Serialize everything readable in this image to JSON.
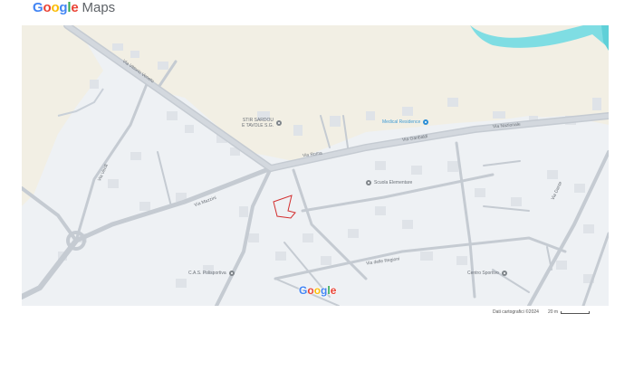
{
  "header": {
    "logo_text": "Google",
    "product_text": "Maps",
    "logo_colors": [
      "#4285F4",
      "#EA4335",
      "#FBBC05",
      "#4285F4",
      "#34A853",
      "#EA4335"
    ]
  },
  "map": {
    "background_color": "#eef1f4",
    "sand_color": "#f2efe4",
    "water_color": "#7fdde3",
    "parcel_outline_color": "#d32f2f",
    "pois": [
      {
        "id": "poi-stir",
        "label_line1": "STIR SARDOU",
        "label_line2": "E TAVOLE S.G.",
        "icon": "place-pin-icon",
        "kind": "place"
      },
      {
        "id": "poi-health",
        "label": "Medical Residence",
        "icon": "health-pin-icon",
        "kind": "health"
      },
      {
        "id": "poi-school",
        "label": "Scuola Elementare",
        "icon": "place-pin-icon",
        "kind": "place"
      },
      {
        "id": "poi-ifs",
        "label": "C.A.S. Polisportiva",
        "icon": "place-pin-icon",
        "kind": "place"
      },
      {
        "id": "poi-east",
        "label": "Centro Sportivo",
        "icon": "place-pin-icon",
        "kind": "place"
      }
    ],
    "street_labels": [
      "Via Vittorio Veneto",
      "Via Roma",
      "Via Garibaldi",
      "Via Nazionale",
      "Via delle Regioni",
      "Via Mazzini",
      "Via Verdi",
      "Via Dante"
    ],
    "watermark": "Google"
  },
  "footer": {
    "attribution": "Dati cartografici ©2024",
    "scale_label": "20 m"
  }
}
